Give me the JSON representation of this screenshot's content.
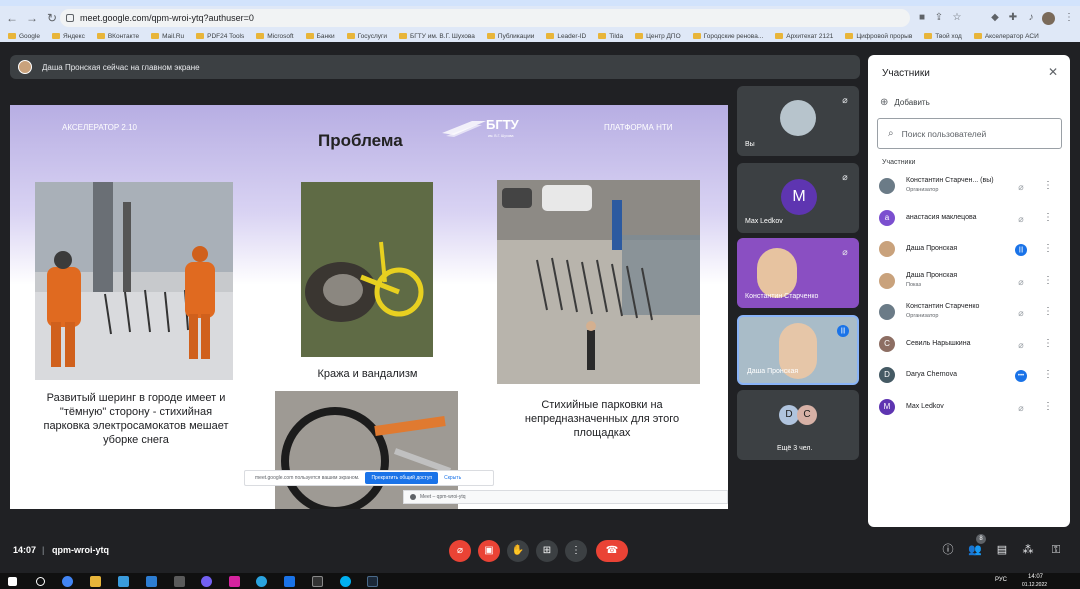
{
  "browser": {
    "url": "meet.google.com/qpm-wroi-ytq?authuser=0",
    "bookmarks": [
      "Google",
      "Яндекс",
      "ВКонтакте",
      "Mail.Ru",
      "PDF24 Tools",
      "Microsoft",
      "Банки",
      "Госуслуги",
      "БГТУ им. В.Г. Шухова",
      "Публикации",
      "Leader-ID",
      "Tilda",
      "Центр ДПО",
      "Городские реновa...",
      "Архитехат 2121",
      "Цифровой прорыв",
      "Твой ход",
      "Акселератор АСИ"
    ]
  },
  "meet": {
    "presenting_text": "Даша Пронская сейчас на главном экране",
    "time": "14:07",
    "meeting_code": "qpm-wroi-ytq",
    "participants_badge": "8"
  },
  "slide": {
    "accelerator": "АКСЕЛЕРАТОР 2.10",
    "title": "Проблема",
    "logo": "БГТУ",
    "logo_sub": "им. В.Г. Шухова",
    "platform": "ПЛАТФОРМА НТИ",
    "caption_left": "Развитый шеринг в городе имеет и \"тёмную\" сторону - стихийная парковка электросамокатов мешает уборке снега",
    "caption_center": "Кража и вандализм",
    "caption_right": "Стихийные парковки на непредназначенных для этого площадках"
  },
  "share_popup": {
    "message": "meet.google.com пользуется вашим экраном.",
    "stop_button": "Прекратить общий доступ",
    "hide_link": "Скрыть"
  },
  "mini_window": {
    "title": "Meet – qpm-wroi-ytq"
  },
  "tiles": [
    {
      "name": "Вы"
    },
    {
      "name": "Max Ledkov",
      "initial": "M"
    },
    {
      "name": "Константин Старченко"
    },
    {
      "name": "Даша Пронская"
    },
    {
      "name": "Ещё 3 чел.",
      "initials": [
        "D",
        "C"
      ]
    }
  ],
  "people_panel": {
    "title": "Участники",
    "add_label": "Добавить",
    "search_placeholder": "Поиск пользователей",
    "section_label": "Участники",
    "people": [
      {
        "name": "Константин Старчен... (вы)",
        "role": "Организатор",
        "mic": "off"
      },
      {
        "name": "анастасия маклецова",
        "initial": "а",
        "color": "#7b4fcf",
        "mic": "off"
      },
      {
        "name": "Даша Пронская",
        "mic": "on"
      },
      {
        "name": "Даша Пронская",
        "role": "Показ",
        "mic": "off"
      },
      {
        "name": "Константин Старченко",
        "role": "Организатор",
        "mic": "off"
      },
      {
        "name": "Севиль Нарышкина",
        "initial": "С",
        "color": "#8d6e63",
        "mic": "off"
      },
      {
        "name": "Darya Chernova",
        "initial": "D",
        "color": "#455a64",
        "mic": "more"
      },
      {
        "name": "Max Ledkov",
        "initial": "M",
        "color": "#5e35b1",
        "mic": "off"
      }
    ]
  },
  "taskbar": {
    "lang": "РУС",
    "time": "14:07",
    "date": "01.12.2022"
  },
  "colors": {
    "background": "#202124",
    "accent": "#1a73e8",
    "danger": "#ea4335"
  }
}
